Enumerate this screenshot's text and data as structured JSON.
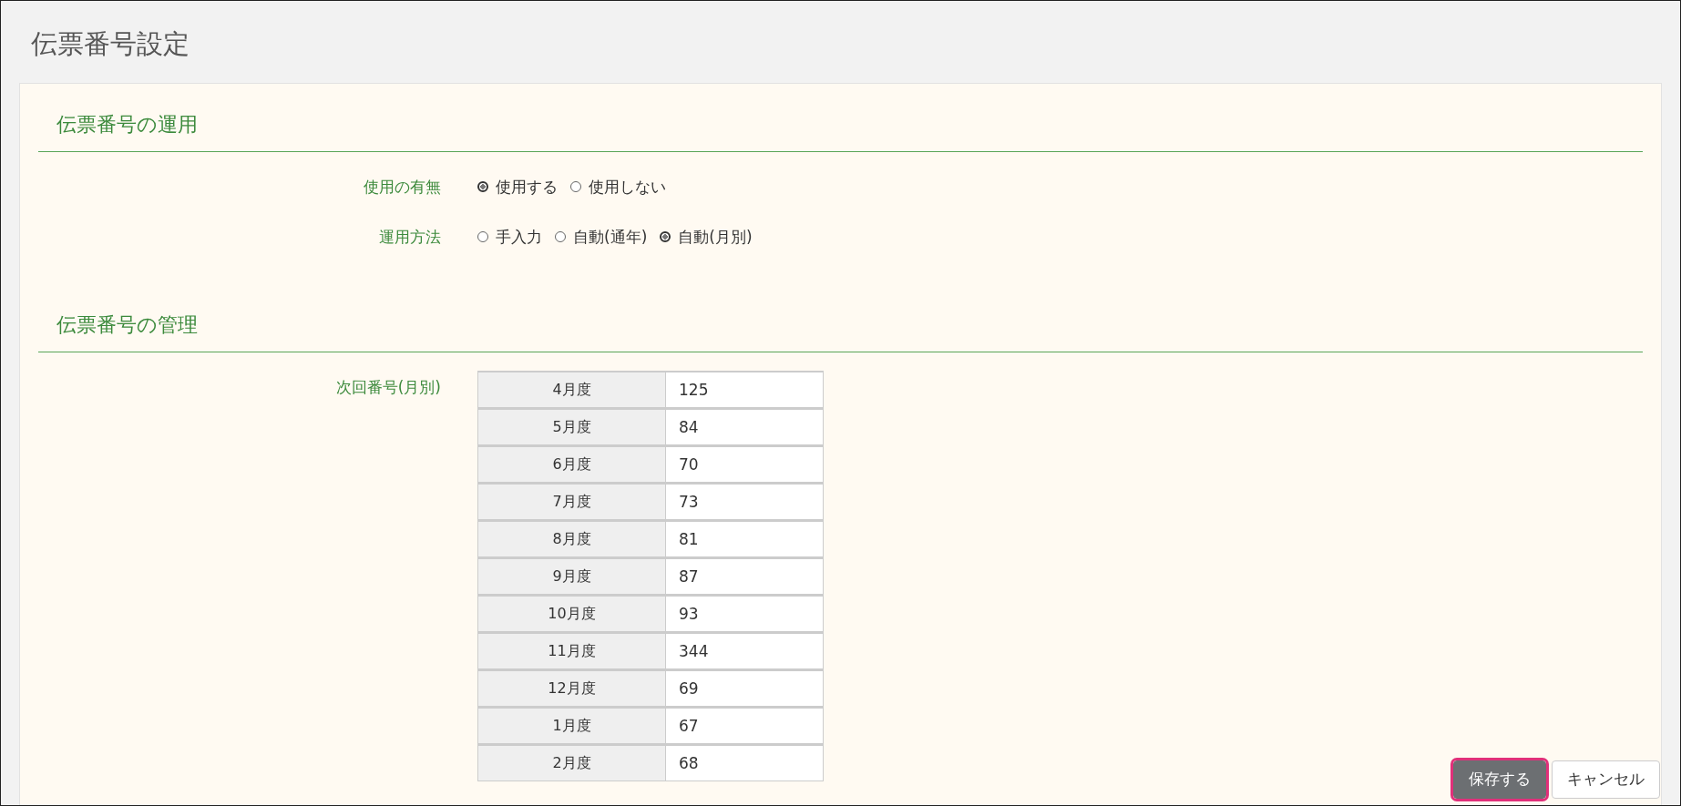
{
  "page_title": "伝票番号設定",
  "sections": [
    {
      "heading": "伝票番号の運用",
      "fields": [
        {
          "label": "使用の有無",
          "kind": "radio",
          "options": [
            {
              "label": "使用する",
              "selected": true
            },
            {
              "label": "使用しない",
              "selected": false
            }
          ]
        },
        {
          "label": "運用方法",
          "kind": "radio",
          "options": [
            {
              "label": "手入力",
              "selected": false
            },
            {
              "label": "自動(通年)",
              "selected": false
            },
            {
              "label": "自動(月別)",
              "selected": true
            }
          ]
        }
      ]
    },
    {
      "heading": "伝票番号の管理",
      "fields": [
        {
          "label": "次回番号(月別)",
          "kind": "table",
          "rows": [
            {
              "month": "4月度",
              "value": "125"
            },
            {
              "month": "5月度",
              "value": "84"
            },
            {
              "month": "6月度",
              "value": "70"
            },
            {
              "month": "7月度",
              "value": "73"
            },
            {
              "month": "8月度",
              "value": "81"
            },
            {
              "month": "9月度",
              "value": "87"
            },
            {
              "month": "10月度",
              "value": "93"
            },
            {
              "month": "11月度",
              "value": "344"
            },
            {
              "month": "12月度",
              "value": "69"
            },
            {
              "month": "1月度",
              "value": "67"
            },
            {
              "month": "2月度",
              "value": "68"
            }
          ]
        }
      ]
    }
  ],
  "footer": {
    "buttons": [
      {
        "label": "保存する",
        "kind": "primary",
        "highlighted": true
      },
      {
        "label": "キャンセル",
        "kind": "default",
        "highlighted": false
      }
    ]
  }
}
